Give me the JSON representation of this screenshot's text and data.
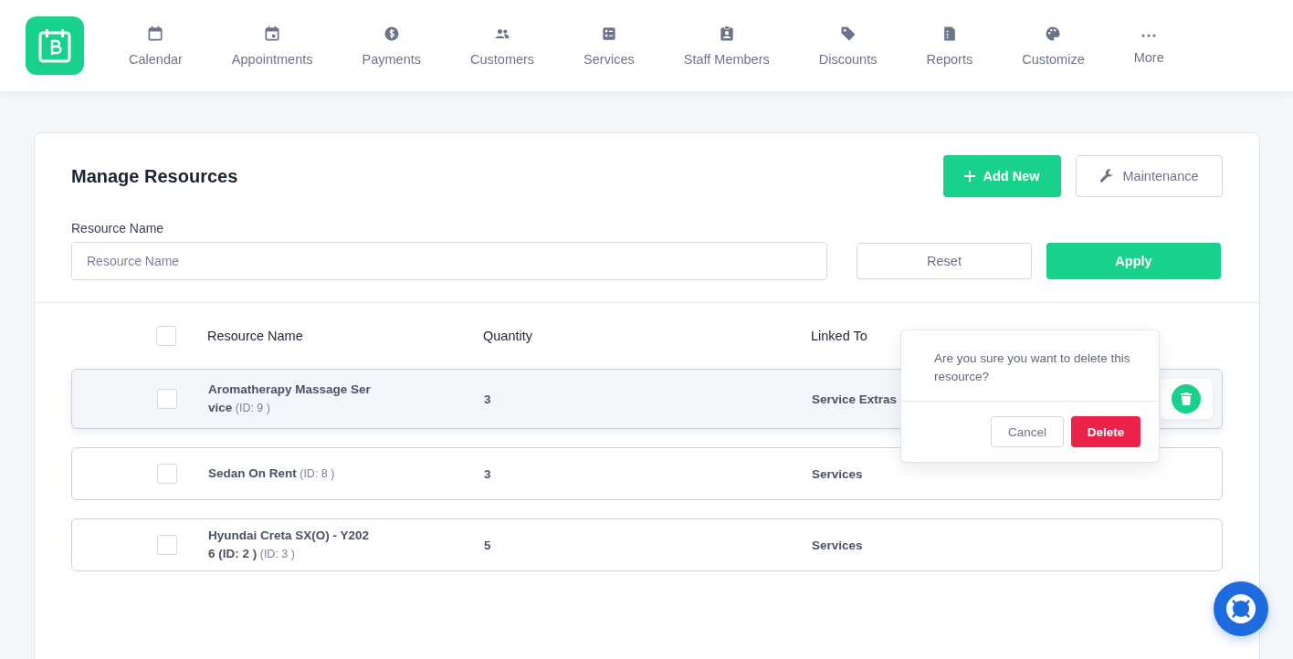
{
  "nav": [
    {
      "label": "Calendar"
    },
    {
      "label": "Appointments"
    },
    {
      "label": "Payments"
    },
    {
      "label": "Customers"
    },
    {
      "label": "Services"
    },
    {
      "label": "Staff Members"
    },
    {
      "label": "Discounts"
    },
    {
      "label": "Reports"
    },
    {
      "label": "Customize"
    },
    {
      "label": "More"
    }
  ],
  "page": {
    "title": "Manage Resources",
    "add_button": "Add New",
    "maintenance_button": "Maintenance"
  },
  "filter": {
    "label": "Resource Name",
    "placeholder": "Resource Name",
    "reset": "Reset",
    "apply": "Apply"
  },
  "table": {
    "select_all_checked": false,
    "columns": [
      "Resource Name",
      "Quantity",
      "Linked To"
    ],
    "rows": [
      {
        "name": "**Aromatherapy Massage Service** (ID: 9 )",
        "quantity": "3",
        "linked_to": "Service Extras",
        "checked": false,
        "highlighted": true
      },
      {
        "name": "**Sedan On Rent** (ID: 8 )",
        "quantity": "3",
        "linked_to": "Services",
        "checked": false,
        "highlighted": false
      },
      {
        "name": "**Hyundai Creta SX(O) - Y2026 (ID: 2 )** (ID: 3 )",
        "quantity": "5",
        "linked_to": "Services",
        "checked": false,
        "highlighted": false
      }
    ]
  },
  "confirm": {
    "message": "Are you sure you want to delete this resource?",
    "cancel": "Cancel",
    "delete": "Delete"
  }
}
